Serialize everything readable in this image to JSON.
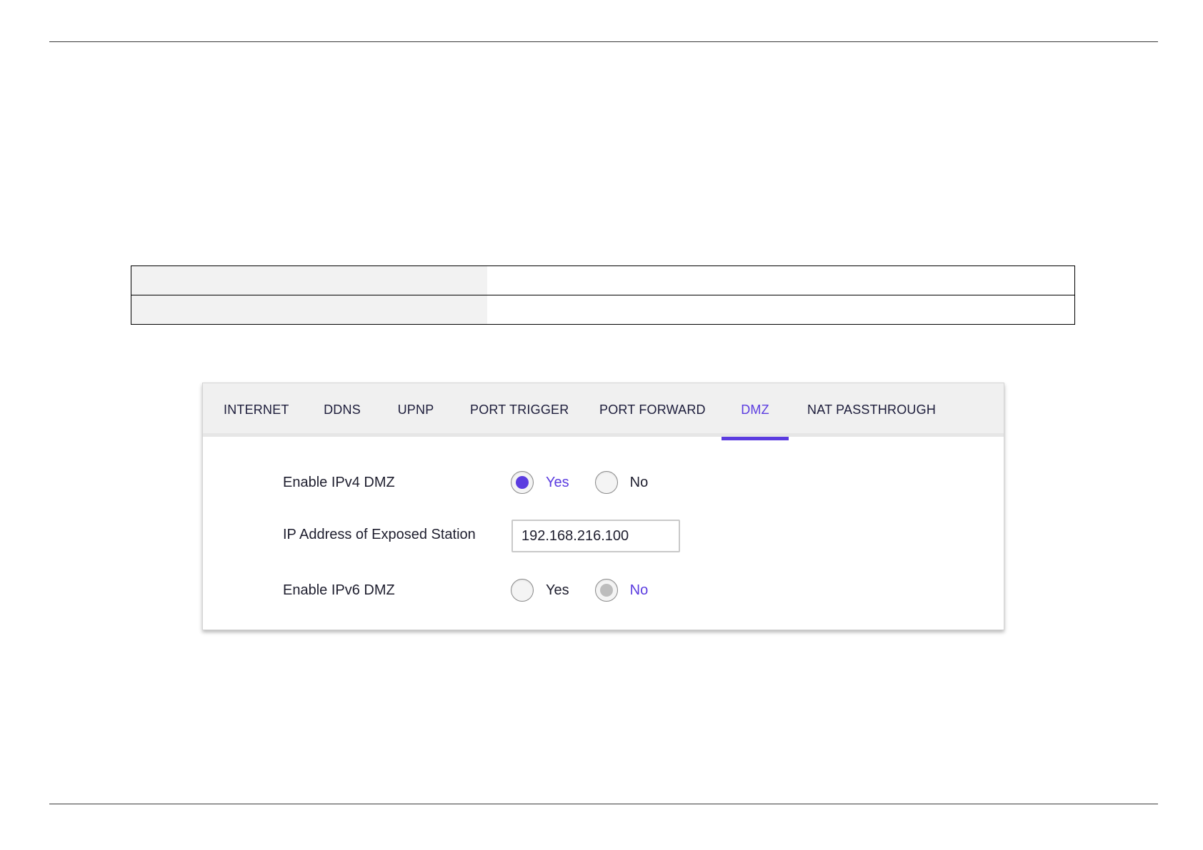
{
  "tabs": [
    {
      "label": "INTERNET",
      "active": false
    },
    {
      "label": "DDNS",
      "active": false
    },
    {
      "label": "UPNP",
      "active": false
    },
    {
      "label": "PORT TRIGGER",
      "active": false
    },
    {
      "label": "PORT FORWARD",
      "active": false
    },
    {
      "label": "DMZ",
      "active": true
    },
    {
      "label": "NAT PASSTHROUGH",
      "active": false
    }
  ],
  "dmz": {
    "ipv4": {
      "label": "Enable IPv4 DMZ",
      "yes_label": "Yes",
      "no_label": "No",
      "selected": "Yes"
    },
    "ip_address": {
      "label": "IP Address of Exposed Station",
      "value": "192.168.216.100"
    },
    "ipv6": {
      "label": "Enable IPv6 DMZ",
      "yes_label": "Yes",
      "no_label": "No",
      "selected": "No"
    }
  },
  "colors": {
    "accent": "#5b3ce0",
    "tab_text": "#1c1c3a",
    "tab_bar_bg": "#f0f0f0",
    "table_key_bg": "#f2f2f2"
  }
}
